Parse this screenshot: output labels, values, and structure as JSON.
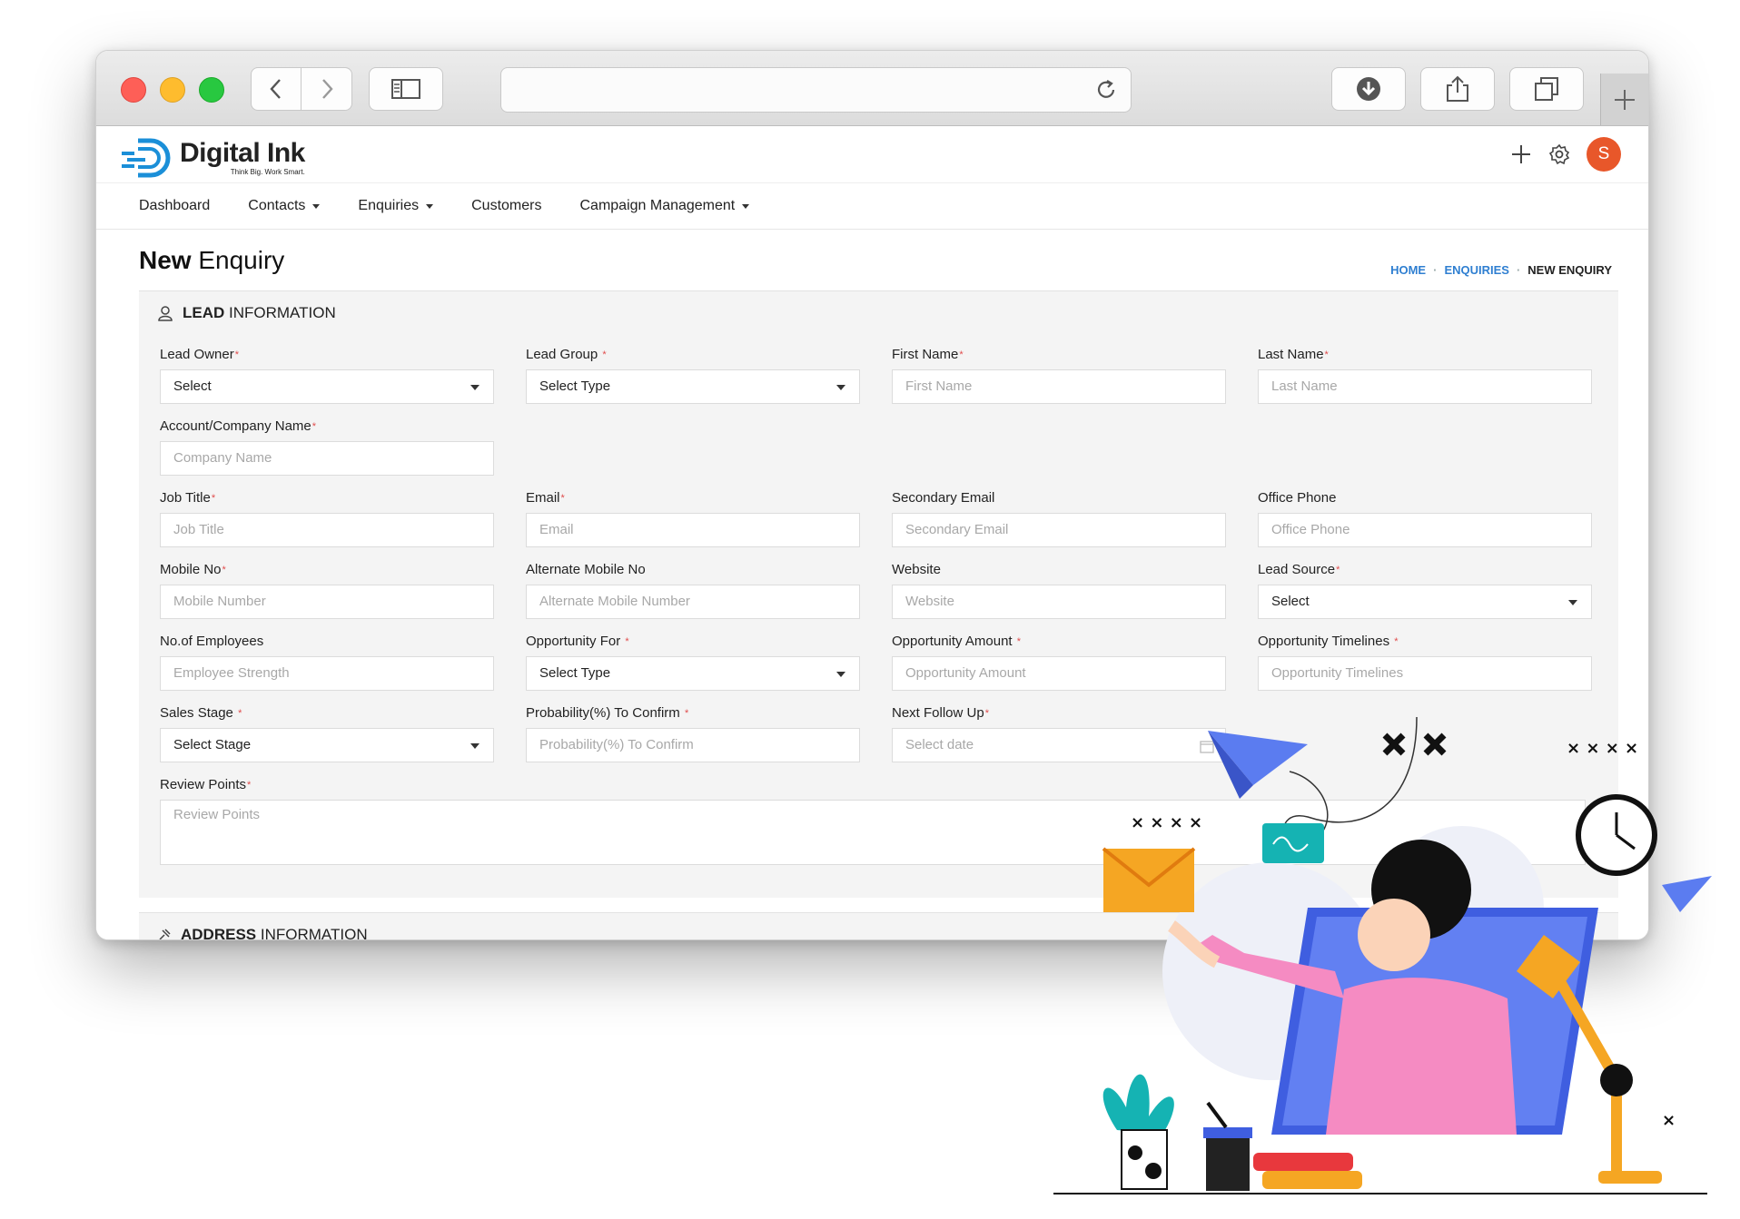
{
  "app": {
    "brand_name": "Digital Ink",
    "brand_tagline": "Think Big. Work Smart.",
    "user_initial": "S"
  },
  "colors": {
    "accent": "#2f7fd1",
    "avatar": "#e8572a",
    "required": "#e04b4b"
  },
  "browser": {
    "icons": [
      "back-icon",
      "forward-icon",
      "sidebar-icon",
      "reload-icon",
      "download-icon",
      "share-icon",
      "tabs-icon",
      "new-tab-icon"
    ]
  },
  "topbar": {
    "icons": [
      "plus-icon",
      "gear-icon"
    ]
  },
  "nav": {
    "items": [
      {
        "label": "Dashboard"
      },
      {
        "label": "Contacts"
      },
      {
        "label": "Enquiries"
      },
      {
        "label": "Customers"
      },
      {
        "label": "Campaign Management"
      }
    ]
  },
  "header": {
    "title_bold": "New",
    "title_rest": "Enquiry",
    "breadcrumb": [
      "HOME",
      "ENQUIRIES",
      "NEW ENQUIRY"
    ]
  },
  "lead_section": {
    "title_bold": "LEAD",
    "title_rest": "INFORMATION",
    "fields": {
      "lead_owner": {
        "label": "Lead Owner",
        "value": "Select"
      },
      "lead_group": {
        "label": "Lead Group",
        "value": "Select Type"
      },
      "first_name": {
        "label": "First Name",
        "placeholder": "First Name"
      },
      "last_name": {
        "label": "Last Name",
        "placeholder": "Last Name"
      },
      "company": {
        "label": "Account/Company Name",
        "placeholder": "Company Name"
      },
      "job_title": {
        "label": "Job Title",
        "placeholder": "Job Title"
      },
      "email": {
        "label": "Email",
        "placeholder": "Email"
      },
      "secondary_email": {
        "label": "Secondary Email",
        "placeholder": "Secondary Email"
      },
      "office_phone": {
        "label": "Office Phone",
        "placeholder": "Office Phone"
      },
      "mobile": {
        "label": "Mobile No",
        "placeholder": "Mobile Number"
      },
      "alt_mobile": {
        "label": "Alternate Mobile No",
        "placeholder": "Alternate Mobile Number"
      },
      "website": {
        "label": "Website",
        "placeholder": "Website"
      },
      "lead_source": {
        "label": "Lead Source",
        "value": "Select"
      },
      "employees": {
        "label": "No.of Employees",
        "placeholder": "Employee Strength"
      },
      "opportunity_for": {
        "label": "Opportunity For",
        "value": "Select Type"
      },
      "opportunity_amount": {
        "label": "Opportunity Amount",
        "placeholder": "Opportunity Amount"
      },
      "opportunity_timelines": {
        "label": "Opportunity Timelines",
        "placeholder": "Opportunity Timelines"
      },
      "sales_stage": {
        "label": "Sales Stage",
        "value": "Select Stage"
      },
      "probability": {
        "label": "Probability(%) To Confirm",
        "placeholder": "Probability(%) To Confirm"
      },
      "next_follow_up": {
        "label": "Next Follow Up",
        "placeholder": "Select date"
      },
      "review_points": {
        "label": "Review Points",
        "placeholder": "Review Points"
      }
    }
  },
  "address_section": {
    "title_bold": "ADDRESS",
    "title_rest": "INFORMATION"
  }
}
